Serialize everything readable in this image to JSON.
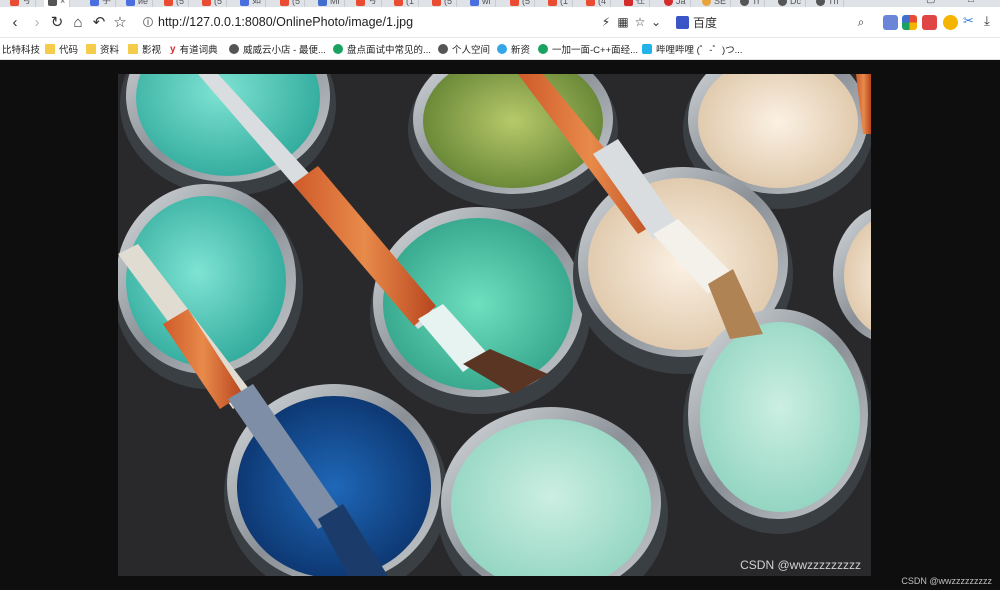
{
  "tabs": [
    {
      "label": "号",
      "icon": "csdn-icon",
      "color": "#e94c32",
      "active": false
    },
    {
      "label": "",
      "icon": "globe-icon",
      "color": "#555555",
      "active": true
    },
    {
      "label": "学",
      "icon": "doc-icon",
      "color": "#4a6ee0",
      "active": false
    },
    {
      "label": "ие",
      "icon": "doc-icon",
      "color": "#4a6ee0",
      "active": false
    },
    {
      "label": "(5",
      "icon": "csdn-icon",
      "color": "#e94c32",
      "active": false
    },
    {
      "label": "(5",
      "icon": "csdn-icon",
      "color": "#e94c32",
      "active": false
    },
    {
      "label": "如",
      "icon": "doc-icon",
      "color": "#4a6ee0",
      "active": false
    },
    {
      "label": "(5",
      "icon": "csdn-icon",
      "color": "#e94c32",
      "active": false
    },
    {
      "label": "Mi",
      "icon": "mvn-icon",
      "color": "#3f6fd1",
      "active": false
    },
    {
      "label": "号",
      "icon": "csdn-icon",
      "color": "#e94c32",
      "active": false
    },
    {
      "label": "(1",
      "icon": "csdn-icon",
      "color": "#e94c32",
      "active": false
    },
    {
      "label": "(5",
      "icon": "csdn-icon",
      "color": "#e94c32",
      "active": false
    },
    {
      "label": "wi",
      "icon": "doc-icon",
      "color": "#4a6ee0",
      "active": false
    },
    {
      "label": "(5",
      "icon": "csdn-icon",
      "color": "#e94c32",
      "active": false
    },
    {
      "label": "(1",
      "icon": "csdn-icon",
      "color": "#e94c32",
      "active": false
    },
    {
      "label": "(4",
      "icon": "csdn-icon",
      "color": "#e94c32",
      "active": false
    },
    {
      "label": "在",
      "icon": "youdao-icon",
      "color": "#d42b2b",
      "active": false
    },
    {
      "label": "Ja",
      "icon": "weibo-icon",
      "color": "#d42b2b",
      "active": false
    },
    {
      "label": "SE",
      "icon": "se-icon",
      "color": "#e9a33b",
      "active": false
    },
    {
      "label": "Tr",
      "icon": "globe-icon",
      "color": "#555555",
      "active": false
    },
    {
      "label": "Dc",
      "icon": "globe-icon",
      "color": "#555555",
      "active": false
    },
    {
      "label": "Th",
      "icon": "globe-icon",
      "color": "#555555",
      "active": false
    }
  ],
  "toolbar": {
    "url": "http://127.0.0.1:8080/OnlinePhoto/image/1.jpg",
    "search_engine_label": "百度"
  },
  "bookmarks": [
    {
      "label": "比特科技",
      "icon": "none"
    },
    {
      "label": "代码",
      "icon": "folder"
    },
    {
      "label": "资料",
      "icon": "folder"
    },
    {
      "label": "影视",
      "icon": "folder"
    },
    {
      "label": "有道词典",
      "icon": "youdao"
    },
    {
      "label": "威威云小店 - 最便...",
      "icon": "globe"
    },
    {
      "label": "盘点面试中常见的...",
      "icon": "green"
    },
    {
      "label": "个人空间",
      "icon": "globe"
    },
    {
      "label": "新资",
      "icon": "blue"
    },
    {
      "label": "一加一面-C++面经...",
      "icon": "green"
    },
    {
      "label": "哔哩哔哩 (゜-゜)つ...",
      "icon": "tv"
    }
  ],
  "content": {
    "photo_watermark": "CSDN @wwzzzzzzzzz",
    "page_watermark": "CSDN @wwzzzzzzzzz"
  },
  "colors": {
    "page_background": "#0e0e0e",
    "teal_paint": "#5fd0c0",
    "blue_paint": "#0d4a8f",
    "cream_paint": "#f3e3cf",
    "green_paint": "#8fae4c",
    "mint_paint": "#bfe8da"
  }
}
